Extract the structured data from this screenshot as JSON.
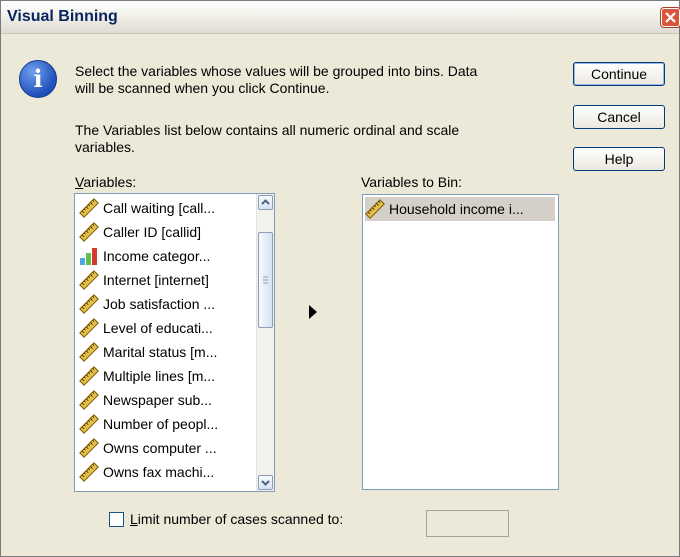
{
  "window": {
    "title": "Visual Binning",
    "close_icon": "close-icon"
  },
  "message": {
    "line1": "Select the variables whose values will be grouped into bins. Data",
    "line2": "will be scanned when you click Continue.",
    "line3": "The Variables list below contains all numeric ordinal and scale",
    "line4": "variables."
  },
  "buttons": {
    "continue": "Continue",
    "cancel": "Cancel",
    "help": "Help"
  },
  "variables": {
    "label_first": "V",
    "label_rest": "ariables:",
    "items": [
      {
        "label": "Call waiting [call...",
        "icon": "ruler-icon"
      },
      {
        "label": "Caller ID [callid]",
        "icon": "ruler-icon"
      },
      {
        "label": "Income categor...",
        "icon": "ordinal-bar-icon"
      },
      {
        "label": "Internet [internet]",
        "icon": "ruler-icon"
      },
      {
        "label": "Job satisfaction ...",
        "icon": "ruler-icon"
      },
      {
        "label": "Level of educati...",
        "icon": "ruler-icon"
      },
      {
        "label": "Marital status [m...",
        "icon": "ruler-icon"
      },
      {
        "label": "Multiple lines [m...",
        "icon": "ruler-icon"
      },
      {
        "label": "Newspaper sub...",
        "icon": "ruler-icon"
      },
      {
        "label": "Number of peopl...",
        "icon": "ruler-icon"
      },
      {
        "label": "Owns computer ...",
        "icon": "ruler-icon"
      },
      {
        "label": "Owns fax machi...",
        "icon": "ruler-icon"
      }
    ]
  },
  "bin": {
    "label": "Variables to Bin:",
    "items": [
      {
        "label": "Household income i...",
        "icon": "ruler-icon"
      }
    ]
  },
  "limit": {
    "label_first": "L",
    "label_rest": "imit number of cases scanned to:",
    "checked": false,
    "value": ""
  }
}
